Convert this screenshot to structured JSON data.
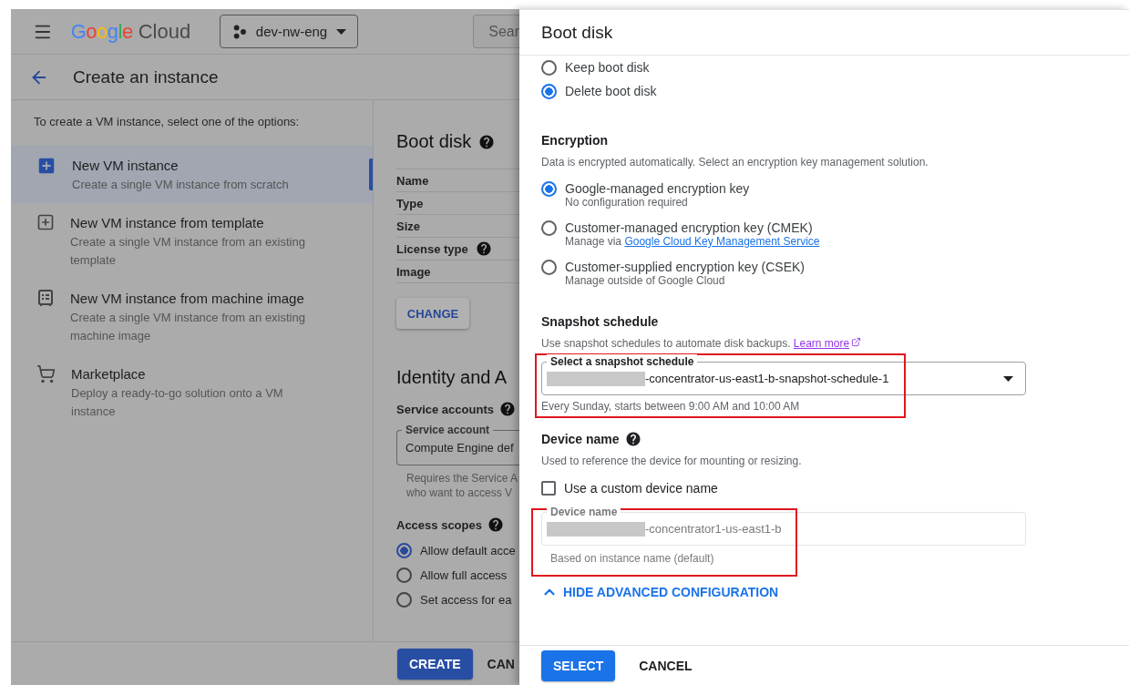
{
  "background_page": {
    "brand": "Google",
    "product": "Cloud",
    "project": "dev-nw-eng",
    "search_placeholder": "Sear",
    "page_title": "Create an instance",
    "intro": "To create a VM instance, select one of the options:",
    "options": [
      {
        "kind": "new",
        "title": "New VM instance",
        "description": "Create a single VM instance from scratch",
        "selected": true
      },
      {
        "kind": "template",
        "title": "New VM instance from template",
        "description": "Create a single VM instance from an existing template",
        "selected": false
      },
      {
        "kind": "machine-image",
        "title": "New VM instance from machine image",
        "description": "Create a single VM instance from an existing machine image",
        "selected": false
      },
      {
        "kind": "marketplace",
        "title": "Marketplace",
        "description": "Deploy a ready-to-go solution onto a VM instance",
        "selected": false
      }
    ],
    "boot_disk_heading": "Boot disk",
    "boot_disk_rows": [
      {
        "label": "Name",
        "help": false
      },
      {
        "label": "Type",
        "help": false
      },
      {
        "label": "Size",
        "help": false
      },
      {
        "label": "License type",
        "help": true
      },
      {
        "label": "Image",
        "help": false
      }
    ],
    "change_button": "CHANGE",
    "identity_heading": "Identity and A",
    "service_accounts_label": "Service accounts",
    "service_account_field": {
      "label": "Service account",
      "value": "Compute Engine def"
    },
    "service_hint": [
      "Requires the Service A",
      "who want to access V"
    ],
    "access_scopes_label": "Access scopes",
    "access_scopes": [
      {
        "label": "Allow default acce",
        "selected": true
      },
      {
        "label": "Allow full access",
        "selected": false
      },
      {
        "label": "Set access for ea",
        "selected": false
      }
    ],
    "create_button": "CREATE",
    "cancel_button": "CAN"
  },
  "panel": {
    "title": "Boot disk",
    "deletion_options": [
      {
        "label": "Keep boot disk",
        "selected": false
      },
      {
        "label": "Delete boot disk",
        "selected": true
      }
    ],
    "encryption": {
      "heading": "Encryption",
      "description": "Data is encrypted automatically. Select an encryption key management solution.",
      "options": [
        {
          "label": "Google-managed encryption key",
          "note": "No configuration required",
          "selected": true
        },
        {
          "label": "Customer-managed encryption key (CMEK)",
          "note": "Manage via",
          "link": "Google Cloud Key Management Service",
          "selected": false
        },
        {
          "label": "Customer-supplied encryption key (CSEK)",
          "note": "Manage outside of Google Cloud",
          "selected": false
        }
      ]
    },
    "snapshot": {
      "heading": "Snapshot schedule",
      "description": "Use snapshot schedules to automate disk backups.",
      "link": "Learn more",
      "highlighted": true,
      "select": {
        "label": "Select a snapshot schedule",
        "value": "-concentrator-us-east1-b-snapshot-schedule-1",
        "redacted": true
      },
      "hint": "Every Sunday, starts between 9:00 AM and 10:00 AM"
    },
    "device": {
      "heading": "Device name",
      "description": "Used to reference the device for mounting or resizing.",
      "custom_checkbox": {
        "label": "Use a custom device name",
        "checked": false
      },
      "highlighted": true,
      "field": {
        "label": "Device name",
        "value": "-concentrator1-us-east1-b",
        "redacted": true,
        "disabled": true
      },
      "hint": "Based on instance name (default)"
    },
    "toggle_advanced": "HIDE ADVANCED CONFIGURATION",
    "select_button": "SELECT",
    "cancel_button": "CANCEL"
  }
}
